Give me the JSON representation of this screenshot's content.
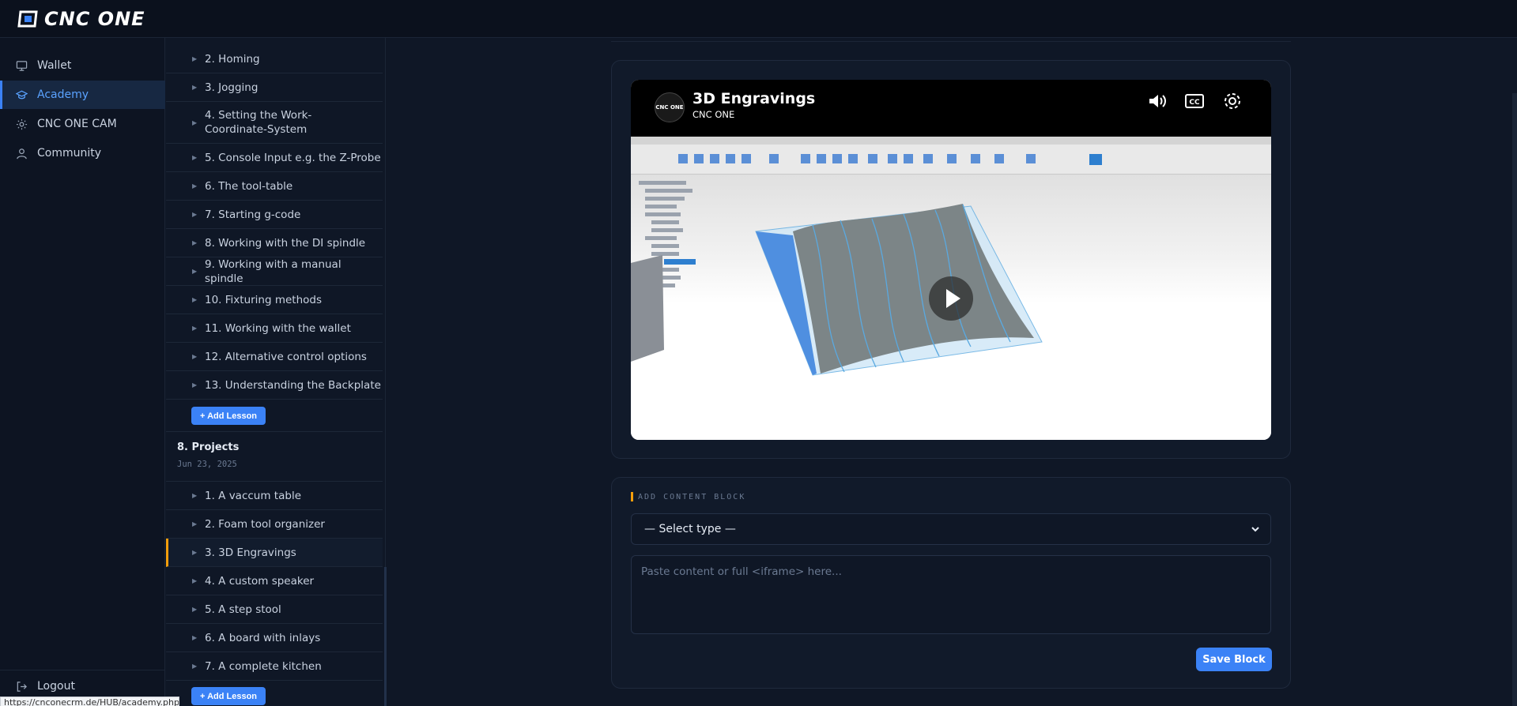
{
  "brand": {
    "name": "CNC ONE"
  },
  "nav": {
    "items": [
      {
        "label": "Wallet",
        "icon": "monitor-icon"
      },
      {
        "label": "Academy",
        "icon": "graduation-cap-icon"
      },
      {
        "label": "CNC ONE CAM",
        "icon": "sun-icon"
      },
      {
        "label": "Community",
        "icon": "user-icon"
      }
    ],
    "logout": "Logout"
  },
  "lessons_prev": [
    "2. Homing",
    "3. Jogging",
    "4. Setting the Work-Coordinate-System",
    "5. Console Input e.g. the Z-Probe",
    "6. The tool-table",
    "7. Starting g-code",
    "8. Working with the DI spindle",
    "9. Working with a manual spindle",
    "10. Fixturing methods",
    "11. Working with the wallet",
    "12. Alternative control options",
    "13. Understanding the Backplate"
  ],
  "add_lesson_label": "+ Add Lesson",
  "section": {
    "title": "8. Projects",
    "date": "Jun 23, 2025"
  },
  "lessons_projects": [
    "1. A vaccum table",
    "2. Foam tool organizer",
    "3. 3D Engravings",
    "4. A custom speaker",
    "5. A step stool",
    "6. A board with inlays",
    "7. A complete kitchen"
  ],
  "video": {
    "title": "3D Engravings",
    "channel": "CNC ONE",
    "avatar_text": "CNC ONE"
  },
  "content_block": {
    "label": "ADD CONTENT BLOCK",
    "select_value": "— Select type —",
    "textarea_placeholder": "Paste content or full <iframe> here...",
    "save_label": "Save Block"
  },
  "status_url": "https://cnconecrm.de/HUB/academy.php",
  "colors": {
    "accent": "#3b82f6",
    "highlight": "#f59e0b",
    "bg": "#0f1726"
  }
}
